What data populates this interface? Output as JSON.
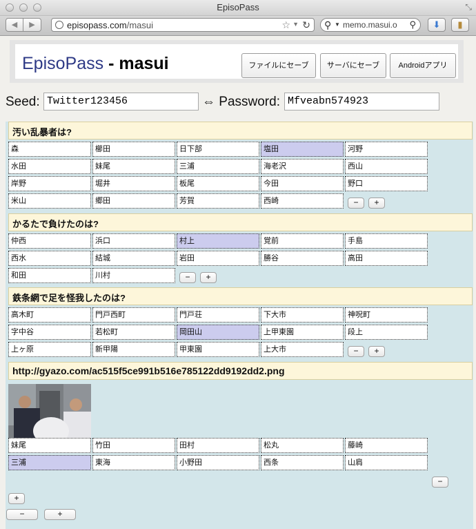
{
  "window": {
    "title": "EpisoPass"
  },
  "browser": {
    "url_domain": "episopass.com",
    "url_path": "/masui",
    "search_value": "memo.masui.o"
  },
  "header": {
    "brand": "EpisoPass",
    "separator": " - ",
    "user": "masui",
    "buttons": [
      "ファイルにセーブ",
      "サーバにセーブ",
      "Androidアプリ"
    ]
  },
  "seed": {
    "label": "Seed:",
    "value": "Twitter123456"
  },
  "arrow": "⇔",
  "password": {
    "label": "Password:",
    "value": "Mfveabn574923"
  },
  "questions": [
    {
      "text": "汚い乱暴者は?",
      "answers": [
        "森",
        "櫛田",
        "日下部",
        "塩田",
        "河野",
        "水田",
        "妹尾",
        "三浦",
        "海老沢",
        "西山",
        "岸野",
        "堀井",
        "板尾",
        "今田",
        "野口",
        "米山",
        "郷田",
        "芳賀",
        "西崎"
      ],
      "selected": 3
    },
    {
      "text": "かるたで負けたのは?",
      "answers": [
        "仲西",
        "浜口",
        "村上",
        "覚前",
        "手島",
        "西水",
        "結城",
        "岩田",
        "勝谷",
        "高田",
        "和田",
        "川村"
      ],
      "selected": 2
    },
    {
      "text": "鉄条網で足を怪我したのは?",
      "answers": [
        "高木町",
        "門戸西町",
        "門戸荘",
        "下大市",
        "神呪町",
        "字中谷",
        "若松町",
        "岡田山",
        "上甲東園",
        "段上",
        "上ヶ原",
        "新甲陽",
        "甲東園",
        "上大市"
      ],
      "selected": 7
    },
    {
      "text": "http://gyazo.com/ac515f5ce991b516e785122dd9192dd2.png",
      "answers": [
        "妹尾",
        "竹田",
        "田村",
        "松丸",
        "藤崎",
        "三浦",
        "東海",
        "小野田",
        "西条",
        "山肩"
      ],
      "selected": 5
    }
  ],
  "controls": {
    "minus": "−",
    "plus": "+"
  },
  "icons": {
    "back": "chevron-left-icon",
    "forward": "chevron-right-icon",
    "globe": "globe-icon",
    "star": "star-icon",
    "reload": "reload-icon",
    "search": "search-icon",
    "download": "download-icon",
    "bookmarks": "bookmarks-icon",
    "resize": "resize-icon"
  },
  "colors": {
    "brand": "#2e3a86",
    "selected_cell": "#ccccee",
    "question_bg": "#fdf6da",
    "panel_bg": "#d3e6ea"
  }
}
